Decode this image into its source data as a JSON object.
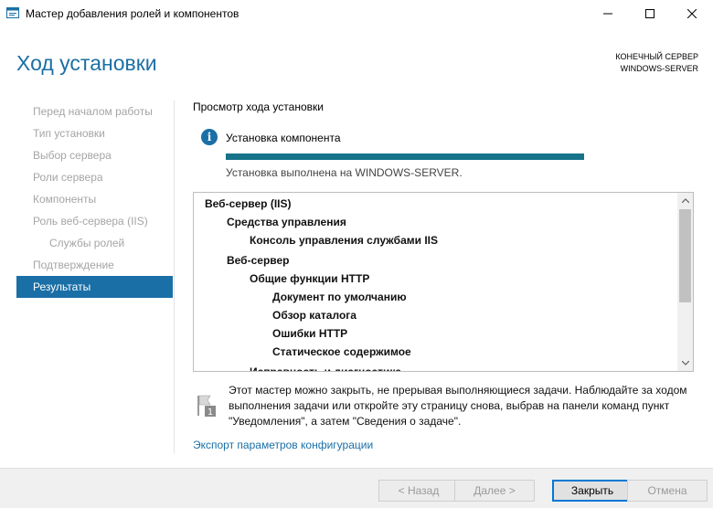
{
  "window": {
    "title": "Мастер добавления ролей и компонентов"
  },
  "header": {
    "page_title": "Ход установки",
    "server_label": "КОНЕЧНЫЙ СЕРВЕР",
    "server_name": "WINDOWS-SERVER"
  },
  "nav": {
    "items": [
      {
        "label": "Перед началом работы"
      },
      {
        "label": "Тип установки"
      },
      {
        "label": "Выбор сервера"
      },
      {
        "label": "Роли сервера"
      },
      {
        "label": "Компоненты"
      },
      {
        "label": "Роль веб-сервера (IIS)"
      },
      {
        "label": "Службы ролей"
      },
      {
        "label": "Подтверждение"
      },
      {
        "label": "Результаты"
      }
    ]
  },
  "main": {
    "section_label": "Просмотр хода установки",
    "status_title": "Установка компонента",
    "progress_percent": 100,
    "status_message": "Установка выполнена на WINDOWS-SERVER.",
    "results": [
      {
        "label": "Веб-сервер (IIS)",
        "level": 0
      },
      {
        "label": "Средства управления",
        "level": 1
      },
      {
        "label": "Консоль управления службами IIS",
        "level": 2
      },
      {
        "label": "Веб-сервер",
        "level": 1
      },
      {
        "label": "Общие функции HTTP",
        "level": 2
      },
      {
        "label": "Документ по умолчанию",
        "level": 3
      },
      {
        "label": "Обзор каталога",
        "level": 3
      },
      {
        "label": "Ошибки HTTP",
        "level": 3
      },
      {
        "label": "Статическое содержимое",
        "level": 3
      },
      {
        "label": "Исправность и диагностика",
        "level": 2
      }
    ],
    "note": "Этот мастер можно закрыть, не прерывая выполняющиеся задачи. Наблюдайте за ходом выполнения задачи или откройте эту страницу снова, выбрав на панели команд пункт \"Уведомления\", а затем \"Сведения о задаче\".",
    "note_badge": "1",
    "export_link": "Экспорт параметров конфигурации"
  },
  "footer": {
    "prev_label": "< Назад",
    "next_label": "Далее >",
    "close_label": "Закрыть",
    "cancel_label": "Отмена"
  },
  "colors": {
    "accent": "#1a6fa6",
    "progress": "#16738a",
    "nav_inactive": "#a5a5a5"
  },
  "icons": {
    "app": "server-manager-icon",
    "info": "info-icon",
    "note": "notification-flag-icon"
  }
}
